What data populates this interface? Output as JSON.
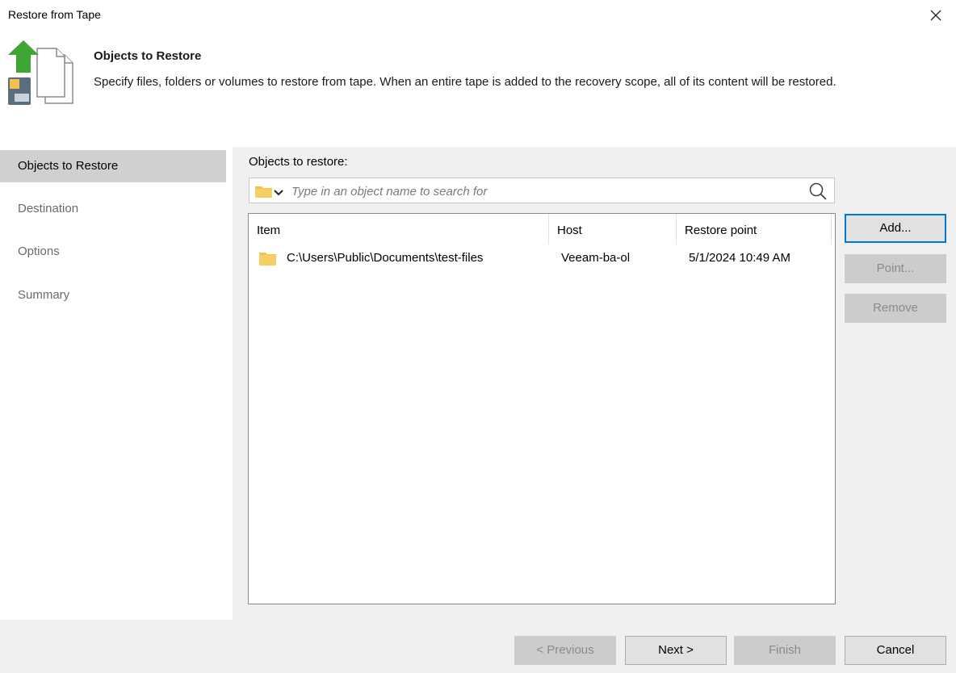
{
  "window": {
    "title": "Restore from Tape",
    "close_icon": "close-icon"
  },
  "header": {
    "title": "Objects to Restore",
    "description": "Specify files, folders or volumes to restore from tape. When an entire tape is added to the recovery scope, all of its content will be restored.",
    "icon": "restore-from-tape-icon"
  },
  "nav": {
    "items": [
      {
        "label": "Objects to Restore",
        "active": true
      },
      {
        "label": "Destination",
        "active": false
      },
      {
        "label": "Options",
        "active": false
      },
      {
        "label": "Summary",
        "active": false
      }
    ]
  },
  "main": {
    "objects_label": "Objects to restore:",
    "search": {
      "placeholder": "Type in an object name to search for",
      "value": ""
    },
    "table": {
      "columns": [
        "Item",
        "Host",
        "Restore point"
      ],
      "rows": [
        {
          "item": "C:\\Users\\Public\\Documents\\test-files",
          "host": "Veeam-ba-ol",
          "restore_point": "5/1/2024 10:49 AM",
          "icon": "folder-icon"
        }
      ]
    },
    "buttons": {
      "add": "Add...",
      "point": "Point...",
      "remove": "Remove"
    }
  },
  "footer": {
    "previous": "< Previous",
    "next": "Next >",
    "finish": "Finish",
    "cancel": "Cancel"
  },
  "colors": {
    "accent": "#0078d7",
    "nav_active": "#d0d0d0",
    "panel": "#f0f0f0",
    "folder": "#f0c050",
    "arrow": "#3fa535"
  }
}
